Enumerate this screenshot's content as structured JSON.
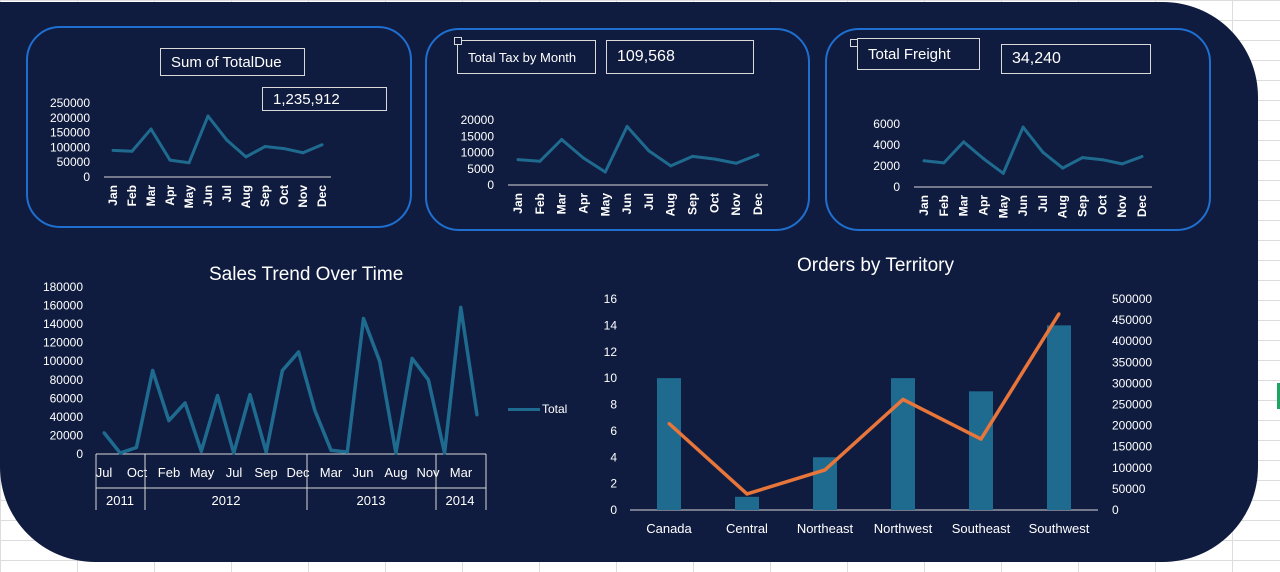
{
  "kpis": [
    {
      "label": "Sum of TotalDue",
      "value": "1,235,912"
    },
    {
      "label": "Total Tax by Month",
      "value": "109,568"
    },
    {
      "label": "Total Freight",
      "value": "34,240"
    }
  ],
  "chart_data": [
    {
      "type": "line",
      "x": [
        "Jan",
        "Feb",
        "Mar",
        "Apr",
        "May",
        "Jun",
        "Jul",
        "Aug",
        "Sep",
        "Oct",
        "Nov",
        "Dec"
      ],
      "series": [
        {
          "values": [
            90000,
            87000,
            162000,
            57000,
            48000,
            206000,
            124000,
            68000,
            103000,
            96000,
            82000,
            109000
          ]
        }
      ],
      "yticks": [
        "250000",
        "200000",
        "150000",
        "100000",
        "50000",
        "0"
      ],
      "ylim": [
        0,
        250000
      ],
      "color": "#1f6b8f"
    },
    {
      "type": "line",
      "x": [
        "Jan",
        "Feb",
        "Mar",
        "Apr",
        "May",
        "Jun",
        "Jul",
        "Aug",
        "Sep",
        "Oct",
        "Nov",
        "Dec"
      ],
      "series": [
        {
          "values": [
            7800,
            7300,
            14000,
            8300,
            4000,
            18000,
            10500,
            5900,
            8800,
            8000,
            6700,
            9300
          ]
        }
      ],
      "yticks": [
        "20000",
        "15000",
        "10000",
        "5000",
        "0"
      ],
      "ylim": [
        0,
        20000
      ],
      "color": "#1f6b8f"
    },
    {
      "type": "line",
      "x": [
        "Jan",
        "Feb",
        "Mar",
        "Apr",
        "May",
        "Jun",
        "Jul",
        "Aug",
        "Sep",
        "Oct",
        "Nov",
        "Dec"
      ],
      "series": [
        {
          "values": [
            2500,
            2300,
            4300,
            2700,
            1300,
            5700,
            3300,
            1800,
            2800,
            2600,
            2200,
            2900
          ]
        }
      ],
      "yticks": [
        "6000",
        "4000",
        "2000",
        "0"
      ],
      "ylim": [
        0,
        6000
      ],
      "color": "#1f6b8f"
    },
    {
      "type": "line",
      "title": "Sales Trend Over Time",
      "legend": "Total",
      "legend_position": "right",
      "series": [
        {
          "name": "Total",
          "values": [
            23000,
            1000,
            7000,
            90000,
            36000,
            55000,
            3000,
            63000,
            1000,
            64000,
            2000,
            90000,
            110000,
            47000,
            4000,
            2000,
            146000,
            100000,
            1000,
            103000,
            80000,
            1000,
            158000,
            42000
          ]
        }
      ],
      "x_month_ticks": [
        "Jul",
        "Oct",
        "Feb",
        "May",
        "Jul",
        "Sep",
        "Dec",
        "Mar",
        "Jun",
        "Aug",
        "Nov",
        "Mar"
      ],
      "x_years": [
        "2011",
        "2012",
        "2013",
        "2014"
      ],
      "yticks": [
        "180000",
        "160000",
        "140000",
        "120000",
        "100000",
        "80000",
        "60000",
        "40000",
        "20000",
        "0"
      ],
      "ylim": [
        0,
        180000
      ],
      "color": "#1f6b8f"
    },
    {
      "type": "bar",
      "title": "Orders by Territory",
      "categories": [
        "Canada",
        "Central",
        "Northeast",
        "Northwest",
        "Southeast",
        "Southwest"
      ],
      "series": [
        {
          "values": [
            10,
            1,
            4,
            10,
            9,
            14
          ],
          "axis": "left",
          "color": "#1f6b8f"
        },
        {
          "values": [
            205000,
            38000,
            95000,
            262000,
            168000,
            465000
          ],
          "axis": "right",
          "type": "line",
          "color": "#e8753a"
        }
      ],
      "y_left_ticks": [
        "16",
        "14",
        "12",
        "10",
        "8",
        "6",
        "4",
        "2",
        "0"
      ],
      "y_right_ticks": [
        "500000",
        "450000",
        "400000",
        "350000",
        "300000",
        "250000",
        "200000",
        "150000",
        "100000",
        "50000",
        "0"
      ],
      "ylim_left": [
        0,
        16
      ],
      "ylim_right": [
        0,
        500000
      ]
    }
  ]
}
